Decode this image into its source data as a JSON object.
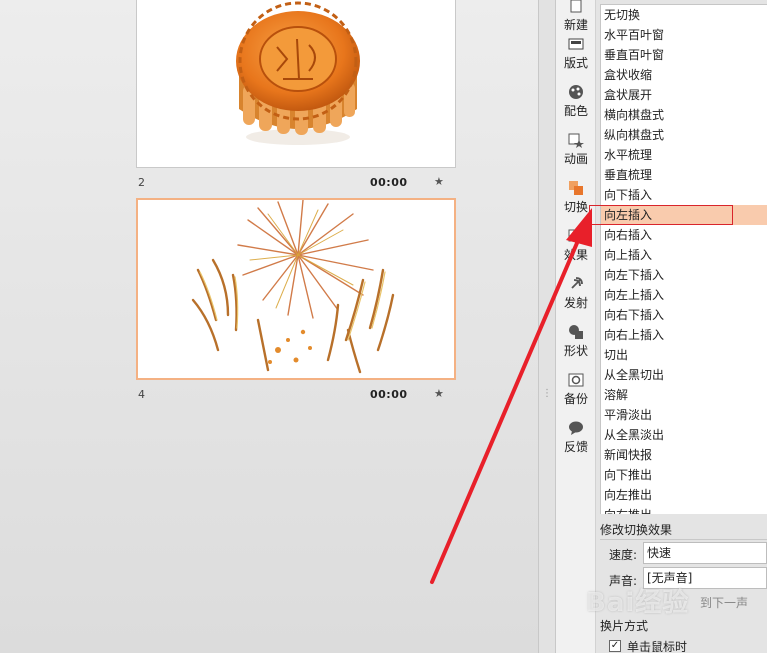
{
  "slides": [
    {
      "number": "2",
      "time": "00:00",
      "star": "★"
    },
    {
      "number": "4",
      "time": "00:00",
      "star": "★"
    }
  ],
  "toolbar": {
    "items": [
      {
        "label": "新建",
        "icon": "new-icon"
      },
      {
        "label": "版式",
        "icon": "layout-icon"
      },
      {
        "label": "配色",
        "icon": "palette-icon"
      },
      {
        "label": "动画",
        "icon": "animation-icon"
      },
      {
        "label": "切换",
        "icon": "transition-icon"
      },
      {
        "label": "效果",
        "icon": "effects-icon"
      },
      {
        "label": "发射",
        "icon": "broadcast-icon"
      },
      {
        "label": "形状",
        "icon": "shapes-icon"
      },
      {
        "label": "备份",
        "icon": "backup-icon"
      },
      {
        "label": "反馈",
        "icon": "feedback-icon"
      }
    ]
  },
  "transitions": {
    "items": [
      "无切换",
      "水平百叶窗",
      "垂直百叶窗",
      "盒状收缩",
      "盒状展开",
      "横向棋盘式",
      "纵向棋盘式",
      "水平梳理",
      "垂直梳理",
      "向下插入",
      "向左插入",
      "向右插入",
      "向上插入",
      "向左下插入",
      "向左上插入",
      "向右下插入",
      "向右上插入",
      "切出",
      "从全黑切出",
      "溶解",
      "平滑淡出",
      "从全黑淡出",
      "新闻快报",
      "向下推出",
      "向左推出",
      "向右推出"
    ],
    "selected": "向左插入"
  },
  "settings": {
    "title": "修改切换效果",
    "speed_label": "速度:",
    "speed_value": "快速",
    "sound_label": "声音:",
    "sound_value": "[无声音]",
    "auto_next_text": "到下一声",
    "advance_title": "换片方式",
    "on_click_label": "单击鼠标时",
    "on_click_checked": "✓"
  },
  "watermark": "Bai经验",
  "colors": {
    "selection": "#f9cbad",
    "outline": "#d9252b",
    "arrow": "#e8202a",
    "thumb_border": "#f4b183"
  }
}
